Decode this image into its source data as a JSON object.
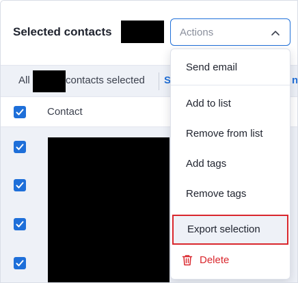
{
  "header": {
    "title": "Selected contacts",
    "actions_placeholder": "Actions"
  },
  "selection_bar": {
    "all_label": "All",
    "selected_text": "contacts selected",
    "link_partial": "S",
    "link_partial_right": "n"
  },
  "table": {
    "contact_header": "Contact",
    "row_count": 4
  },
  "menu": {
    "send_email": "Send email",
    "add_to_list": "Add to list",
    "remove_from_list": "Remove from list",
    "add_tags": "Add tags",
    "remove_tags": "Remove tags",
    "export_selection": "Export selection",
    "delete": "Delete"
  },
  "colors": {
    "accent": "#1e6fd9",
    "danger": "#d9262c",
    "highlight_bg": "#eef1f7"
  },
  "icons": {
    "actions": "chevron-up-icon",
    "delete": "trash-icon",
    "checkbox": "checkmark-icon"
  }
}
